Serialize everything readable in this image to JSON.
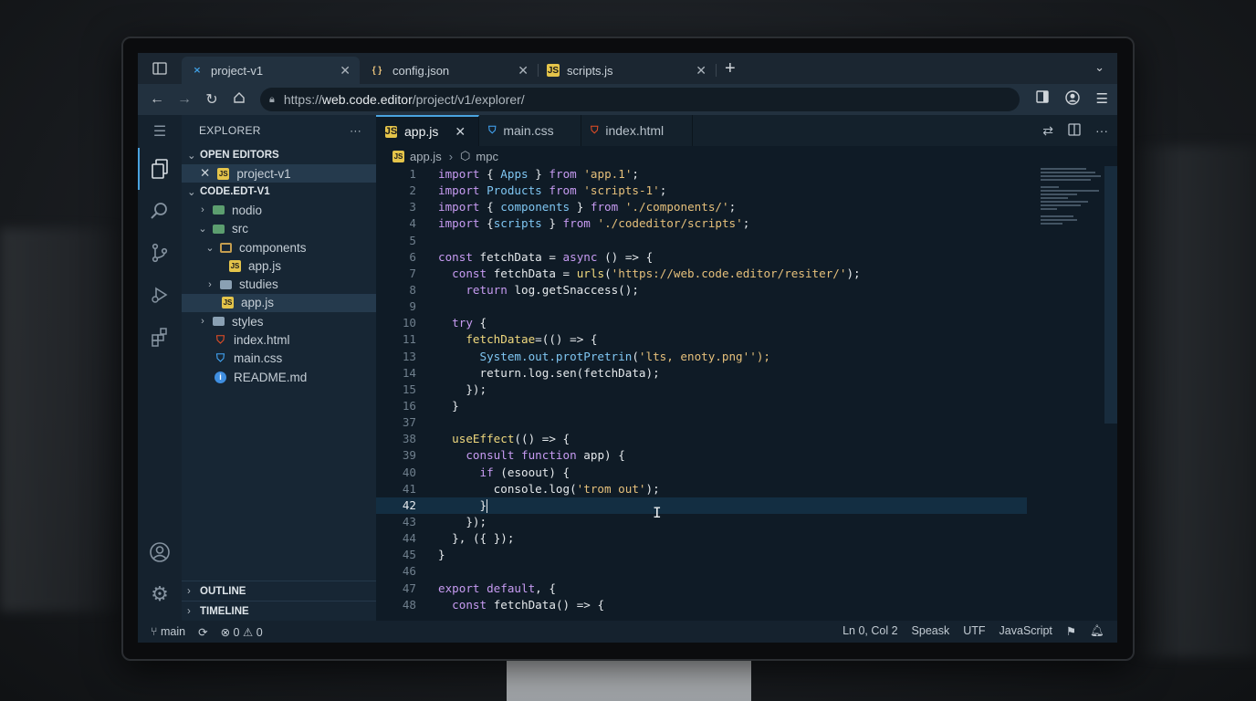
{
  "browser": {
    "tabs": [
      {
        "label": "project-v1",
        "icon": "vscode-icon",
        "active": true
      },
      {
        "label": "config.json",
        "icon": "json-braces-icon",
        "active": false
      },
      {
        "label": "scripts.js",
        "icon": "js-file-icon",
        "active": false
      }
    ],
    "url_prefix": "https://",
    "url_host": "web.code.editor",
    "url_path": "/project/v1/explorer/"
  },
  "sidebar": {
    "title": "EXPLORER",
    "more": "···",
    "open_editors_label": "OPEN EDITORS",
    "open_editor_item": "project-v1",
    "root_label": "CODE.EDT-V1",
    "tree": [
      {
        "label": "nodio",
        "type": "folder"
      },
      {
        "label": "src",
        "type": "folder"
      },
      {
        "label": "components",
        "type": "folder"
      },
      {
        "label": "app.js",
        "type": "js"
      },
      {
        "label": "studies",
        "type": "folder"
      },
      {
        "label": "app.js",
        "type": "js"
      },
      {
        "label": "styles",
        "type": "folder"
      },
      {
        "label": "index.html",
        "type": "html"
      },
      {
        "label": "main.css",
        "type": "css"
      },
      {
        "label": "README.md",
        "type": "info"
      }
    ],
    "outline_label": "OUTLINE",
    "timeline_label": "TIMELINE"
  },
  "editor": {
    "tabs": [
      {
        "label": "app.js",
        "icon": "js",
        "active": true
      },
      {
        "label": "main.css",
        "icon": "css",
        "active": false
      },
      {
        "label": "index.html",
        "icon": "html",
        "active": false
      }
    ],
    "breadcrumb_file": "app.js",
    "breadcrumb_symbol": "mpc",
    "current_line": 42,
    "lines": [
      {
        "n": "1",
        "t": "import { Apps } from 'app.1';"
      },
      {
        "n": "2",
        "t": "import Products from 'scripts-1';"
      },
      {
        "n": "3",
        "t": "import { components } from './components/';"
      },
      {
        "n": "4",
        "t": "import {scripts } from './codeditor/scripts';"
      },
      {
        "n": "5",
        "t": ""
      },
      {
        "n": "6",
        "t": "const fetchData = async () => {"
      },
      {
        "n": "7",
        "t": "  const fetchData = urls('https://web.code.editor/resiter/');"
      },
      {
        "n": "8",
        "t": "    return log.getSnaccess();"
      },
      {
        "n": "9",
        "t": ""
      },
      {
        "n": "10",
        "t": "  try {"
      },
      {
        "n": "11",
        "t": "    fetchDatae=(() => {"
      },
      {
        "n": "13",
        "t": "      System.out.protPretrin('lts, enoty.png'');"
      },
      {
        "n": "14",
        "t": "      return.log.sen(fetchData);"
      },
      {
        "n": "15",
        "t": "    });"
      },
      {
        "n": "16",
        "t": "  }"
      },
      {
        "n": "37",
        "t": ""
      },
      {
        "n": "38",
        "t": "  useEffect(() => {"
      },
      {
        "n": "39",
        "t": "    consult function app) {"
      },
      {
        "n": "40",
        "t": "      if (esoout) {"
      },
      {
        "n": "41",
        "t": "        console.log('trom out');"
      },
      {
        "n": "42",
        "t": "      }"
      },
      {
        "n": "43",
        "t": "    });"
      },
      {
        "n": "44",
        "t": "  }, ({ });"
      },
      {
        "n": "45",
        "t": "}"
      },
      {
        "n": "46",
        "t": ""
      },
      {
        "n": "47",
        "t": "export default, {"
      },
      {
        "n": "48",
        "t": "  const fetchData() => {"
      }
    ]
  },
  "status": {
    "branch": "main",
    "errors": "0",
    "warnings": "0",
    "position": "Ln 0, Col 2",
    "indent": "Speask",
    "encoding": "UTF",
    "language": "JavaScript"
  },
  "colors": {
    "accent": "#4aa3df",
    "keyword": "#c79bf2",
    "string": "#e6c07b",
    "function": "#f0d97e",
    "js_icon": "#e4c44a",
    "html_icon": "#e44d26",
    "css_icon": "#42a5f5"
  }
}
